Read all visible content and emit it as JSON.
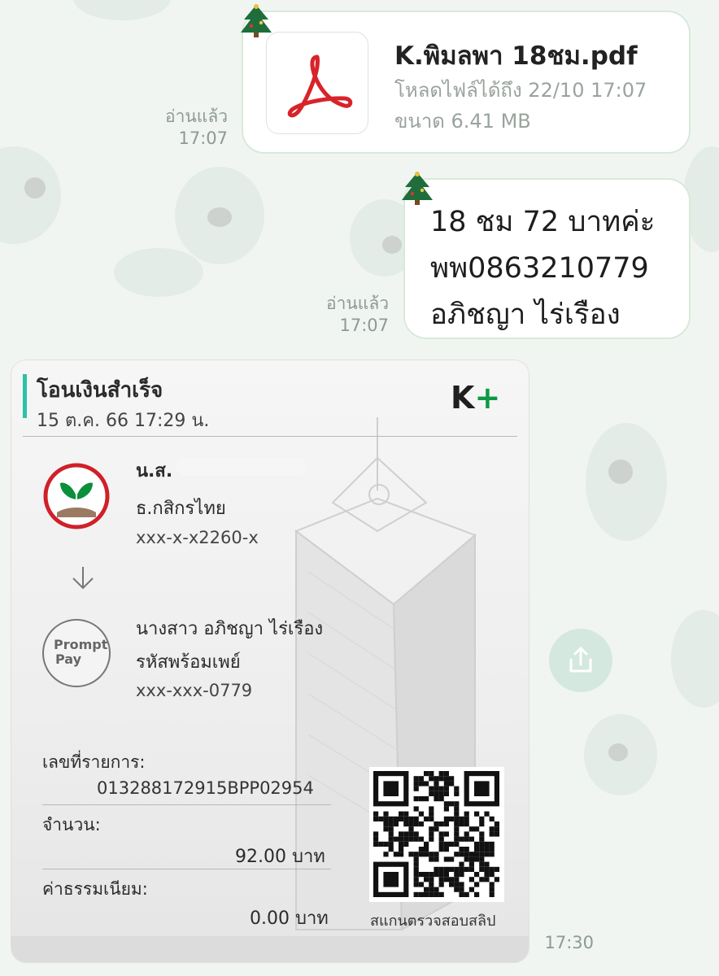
{
  "chat": {
    "messages": [
      {
        "type": "file",
        "file_name": "K.พิมลพา 18ชม.pdf",
        "download_until": "โหลดไฟล์ได้ถึง 22/10 17:07",
        "size": "ขนาด 6.41 MB",
        "read_label": "อ่านแล้ว",
        "time": "17:07"
      },
      {
        "type": "text",
        "lines": [
          "18 ชม 72 บาทค่ะ",
          "พพ0863210779",
          "อภิชญา ไร่เรือง"
        ],
        "read_label": "อ่านแล้ว",
        "time": "17:07"
      }
    ],
    "image_message": {
      "time": "17:30"
    }
  },
  "slip": {
    "title": "โอนเงินสำเร็จ",
    "datetime": "15 ต.ค. 66  17:29 น.",
    "brand": "K+",
    "sender": {
      "name": "น.ส.",
      "bank": "ธ.กสิกรไทย",
      "account": "xxx-x-x2260-x"
    },
    "receiver": {
      "name": "นางสาว อภิชญา ไร่เรือง",
      "method": "รหัสพร้อมเพย์",
      "account": "xxx-xxx-0779",
      "logo_line1": "Prompt",
      "logo_line2": "Pay"
    },
    "ref_label": "เลขที่รายการ:",
    "ref_value": "013288172915BPP02954",
    "amount_label": "จำนวน:",
    "amount_value": "92.00 บาท",
    "fee_label": "ค่าธรรมเนียม:",
    "fee_value": "0.00 บาท",
    "qr_caption": "สแกนตรวจสอบสลิป"
  },
  "colors": {
    "bubble_border": "#d7ead9",
    "accent": "#2dc1a7",
    "kbank_green": "#0a8f3a",
    "kbank_red": "#d0202a"
  },
  "icons": [
    "christmas-tree-icon",
    "pdf-icon",
    "kbank-logo-icon",
    "arrow-down-icon",
    "promptpay-logo-icon",
    "qr-code",
    "share-icon"
  ]
}
